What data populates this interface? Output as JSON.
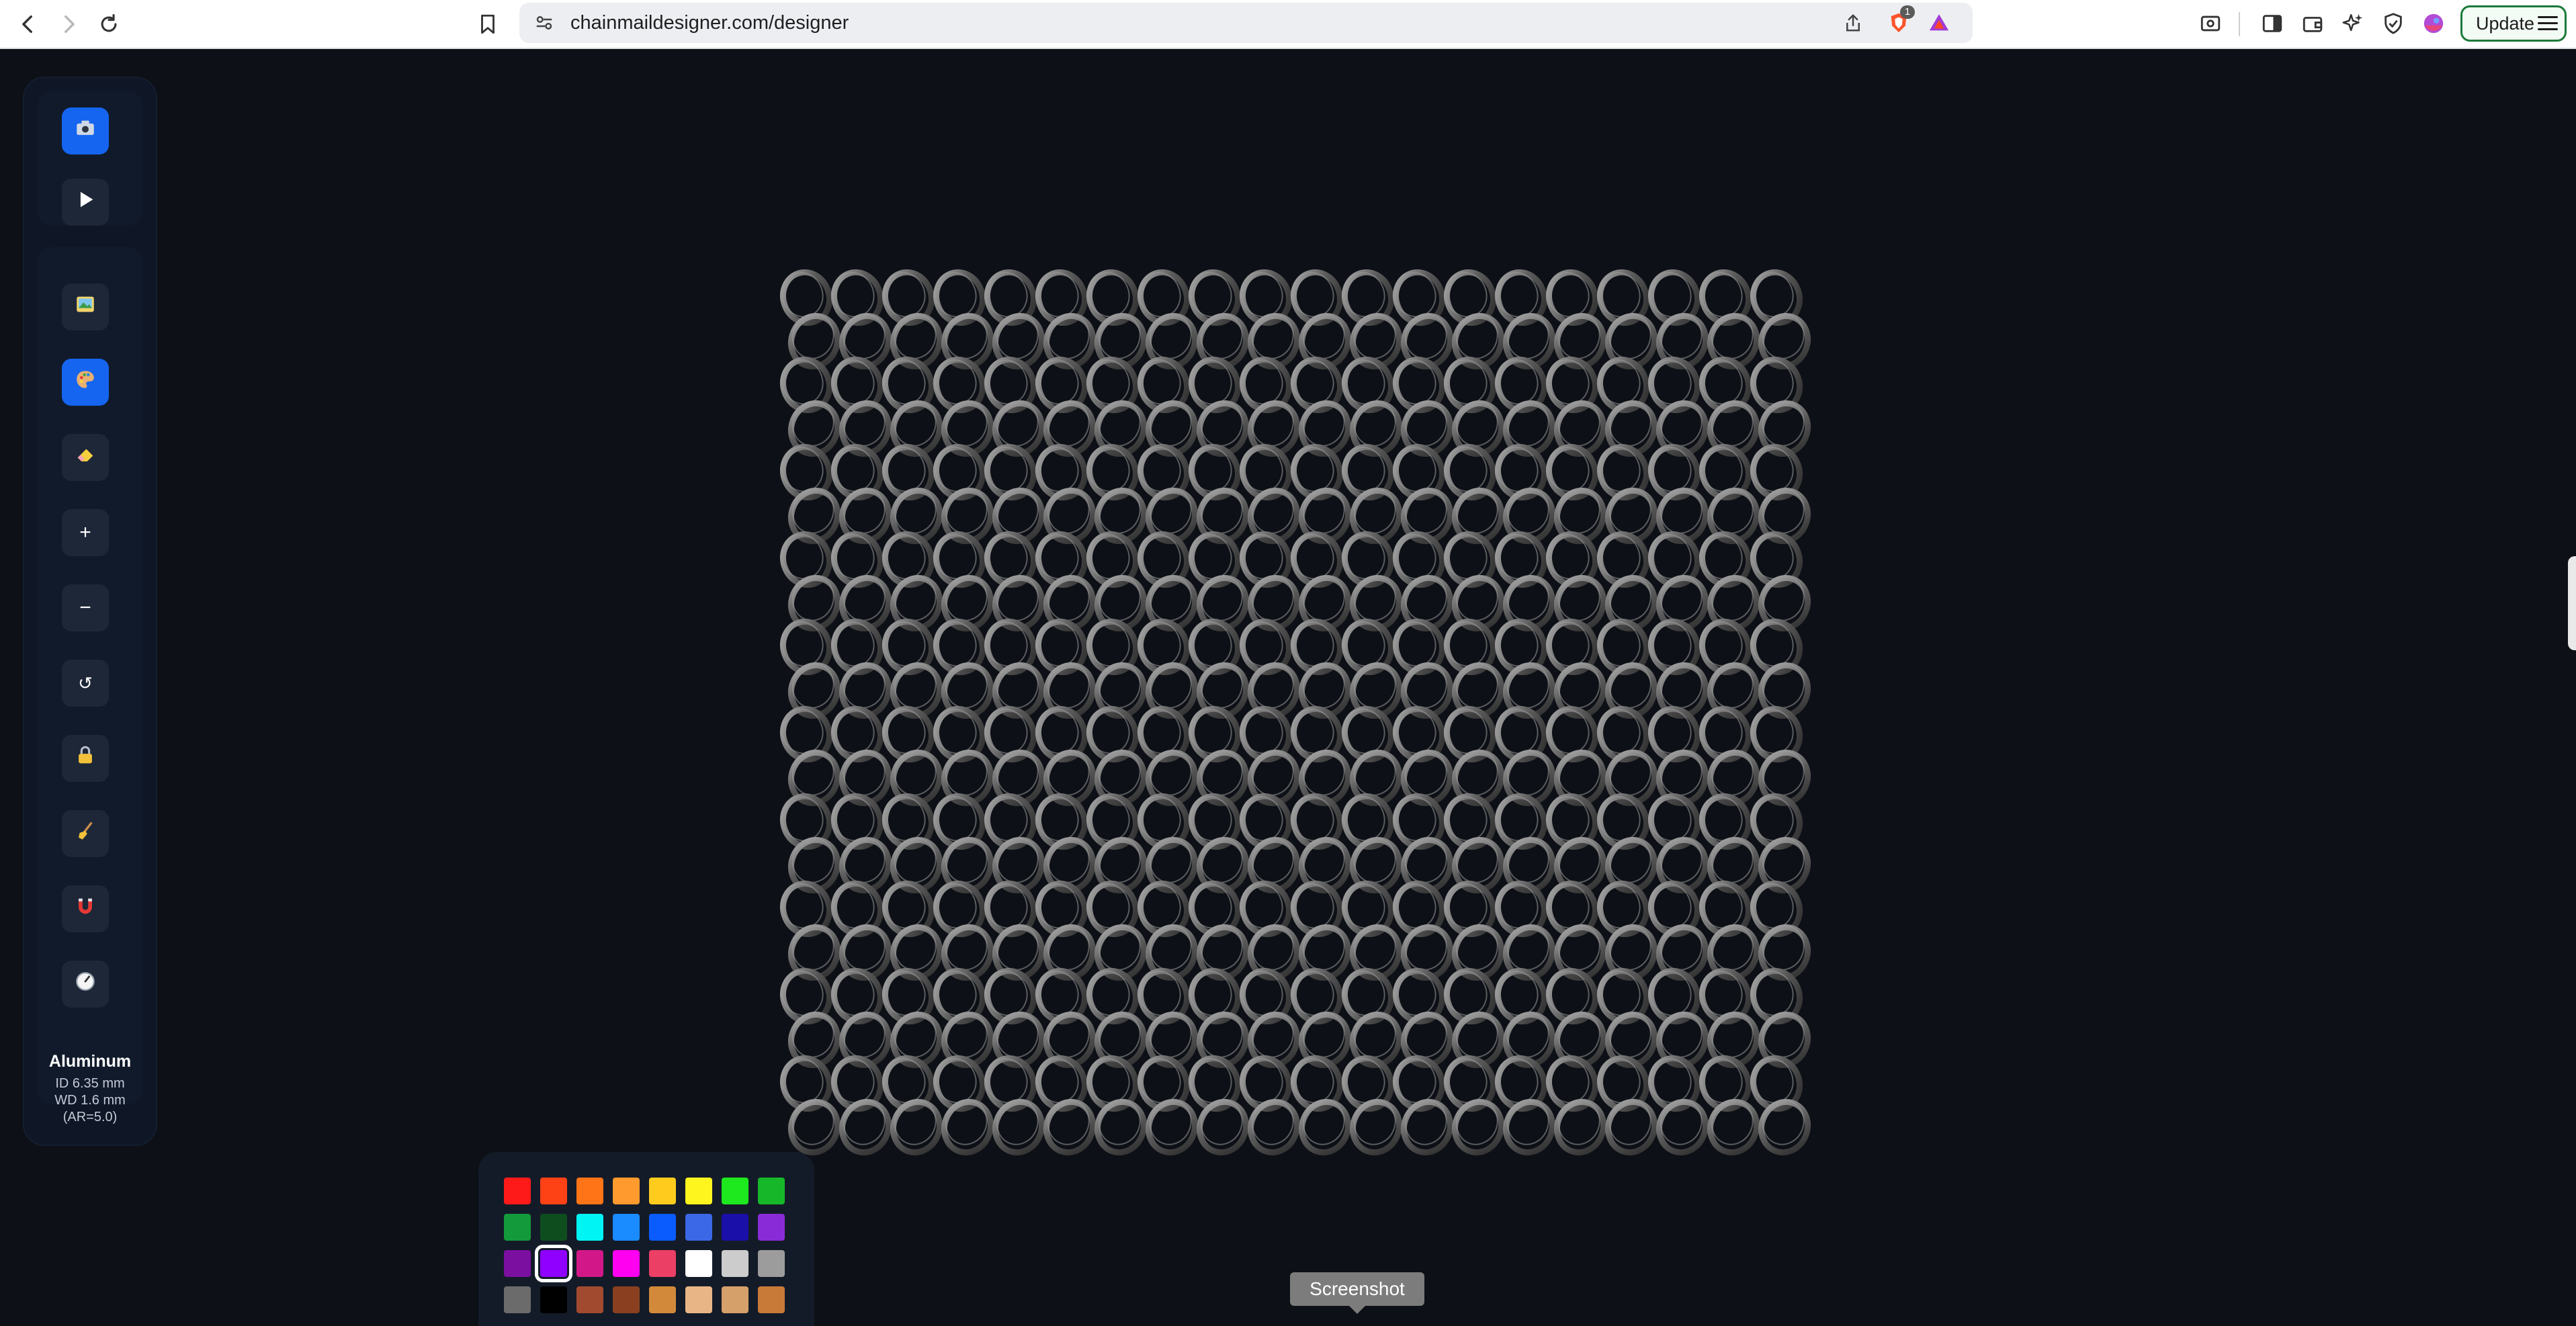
{
  "browser": {
    "url": "chainmaildesigner.com/designer",
    "update_label": "Update",
    "shield_badge": "1"
  },
  "toolbar": {
    "buttons": [
      {
        "name": "camera-icon",
        "active": true
      },
      {
        "name": "play-icon",
        "active": false
      },
      {
        "name": "image-icon",
        "active": false
      },
      {
        "name": "paint-palette-icon",
        "active": true
      },
      {
        "name": "eraser-icon",
        "active": false
      },
      {
        "name": "zoom-in-icon",
        "glyph": "+",
        "active": false
      },
      {
        "name": "zoom-out-icon",
        "glyph": "−",
        "active": false
      },
      {
        "name": "reset-icon",
        "glyph": "↺",
        "active": false
      },
      {
        "name": "lock-icon",
        "active": false
      },
      {
        "name": "broom-icon",
        "active": false
      },
      {
        "name": "magnet-icon",
        "active": false
      },
      {
        "name": "compass-icon",
        "active": false
      }
    ],
    "material": {
      "name": "Aluminum",
      "id": "ID 6.35 mm",
      "wd": "WD 1.6 mm",
      "ar": "(AR=5.0)"
    }
  },
  "weave": {
    "columns": 20,
    "rows": 20,
    "ring_color": "#7a7a7a"
  },
  "palette": {
    "selected_index": 17,
    "colors": [
      "#ff1a1a",
      "#ff4216",
      "#ff7417",
      "#ff9a2e",
      "#ffcc1e",
      "#fff51e",
      "#1ee81e",
      "#16b82a",
      "#139a3a",
      "#0e4e1e",
      "#00f4f4",
      "#1a8cff",
      "#0a5cff",
      "#3b68e6",
      "#1a0fa8",
      "#8a2bd8",
      "#7a0fa0",
      "#8f00ff",
      "#d21888",
      "#ff00f0",
      "#ec3f66",
      "#ffffff",
      "#cccccc",
      "#9c9c9c",
      "#6b6b6b",
      "#000000",
      "#a24a30",
      "#8a4020",
      "#d28a3a",
      "#e8b686",
      "#d6a06a",
      "#c87a38"
    ]
  },
  "tooltip": {
    "text": "Screenshot"
  }
}
